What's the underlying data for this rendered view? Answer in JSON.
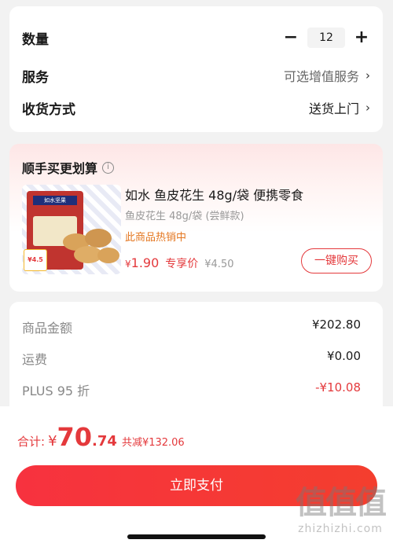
{
  "options": {
    "quantity_label": "数量",
    "quantity_value": "12",
    "minus": "−",
    "plus": "+",
    "service_label": "服务",
    "service_value": "可选增值服务",
    "delivery_label": "收货方式",
    "delivery_value": "送货上门",
    "chevron": "›"
  },
  "deal": {
    "title": "顺手买更划算",
    "info": "i",
    "product": {
      "name": "如水 鱼皮花生 48g/袋 便携零食",
      "spec": "鱼皮花生 48g/袋 (尝鲜款)",
      "status": "此商品热销中",
      "price_currency": "¥",
      "price": "1.90",
      "price_tag": "专享价",
      "original_price": "¥4.50",
      "image_brand": "如水坚果",
      "image_price": "¥4.5"
    },
    "buy_button": "一键购买"
  },
  "summary": {
    "rows": [
      {
        "label": "商品金额",
        "value": "¥202.80"
      },
      {
        "label": "运费",
        "value": "¥0.00"
      },
      {
        "label": "PLUS 95 折",
        "value": "-¥10.08"
      }
    ]
  },
  "footer": {
    "total_label": "合计:",
    "currency": "¥",
    "total_int": "70",
    "total_dec": ".74",
    "saved": "共减¥132.06",
    "pay_button": "立即支付"
  },
  "watermark": {
    "logo": "值值值",
    "url": "zhizhizhi.com"
  },
  "colors": {
    "accent": "#e4393c",
    "hot": "#e4761f",
    "background": "#f2f2f2"
  }
}
